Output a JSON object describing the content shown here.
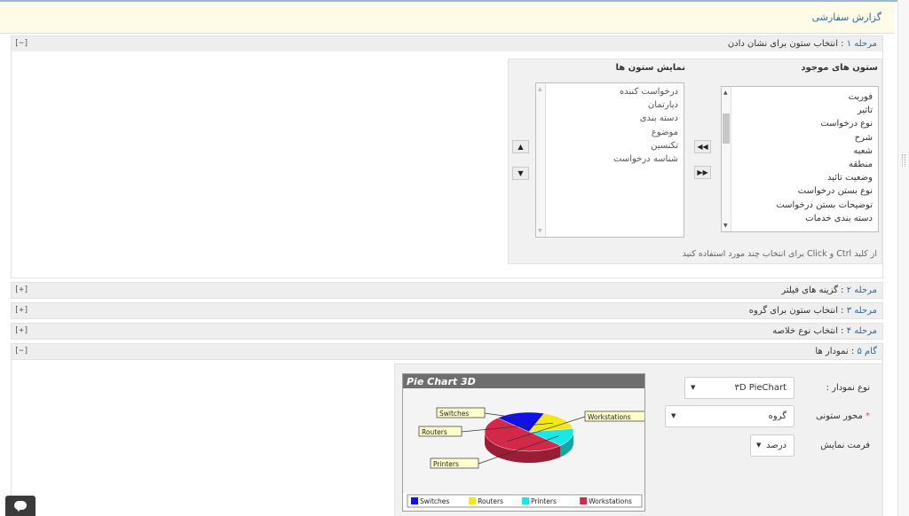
{
  "header": {
    "title": "گزارش سفارشی"
  },
  "steps": [
    {
      "num": "مرحله ۱",
      "title": "انتخاب ستون برای نشان دادن",
      "toggle": "[−]"
    },
    {
      "num": "مرحله ۲",
      "title": "گزینه های فیلتر",
      "toggle": "[+]"
    },
    {
      "num": "مرحله ۳",
      "title": "انتخاب ستون برای گروه",
      "toggle": "[+]"
    },
    {
      "num": "مرحله ۴",
      "title": "انتخاب نوع خلاصه",
      "toggle": "[+]"
    },
    {
      "num": "گام ۵",
      "title": "نمودار ها",
      "toggle": "[−]"
    }
  ],
  "step1": {
    "available_heading": "ستون های موجود",
    "display_heading": "نمایش ستون ها",
    "available_items": [
      "فوریت",
      "تاثیر",
      "نوع درخواست",
      "شرح",
      "شعبه",
      "منطقه",
      "وضعیت تائید",
      "نوع بستن درخواست",
      "توضیحات بستن درخواست",
      "دسته بندی خدمات"
    ],
    "display_items": [
      "درخواست کننده",
      "دپارتمان",
      "دسته بندی",
      "موضوع",
      "تکنسین",
      "شناسه درخواست"
    ],
    "hint": "از کلید Ctrl و Click برای انتخاب چند مورد استفاده کنید",
    "icons": {
      "move_left": "double-left-arrow-icon",
      "move_right": "double-right-arrow-icon",
      "move_up": "up-arrow-icon",
      "move_down": "down-arrow-icon"
    }
  },
  "step5": {
    "chart_type_label": "نوع نمودار :",
    "chart_type_value": "۳D PieChart",
    "axis_label": "محور ستونی",
    "axis_required_mark": "*",
    "axis_value": "گروه",
    "format_label": "فرمت نمایش",
    "format_value": "درصد"
  },
  "chart_data": {
    "type": "pie",
    "title": "Pie Chart 3D",
    "categories": [
      "Switches",
      "Routers",
      "Printers",
      "Workstations"
    ],
    "values": [
      18,
      17,
      15,
      50
    ],
    "colors": [
      "#1010e8",
      "#f0e818",
      "#18e8e8",
      "#d42848"
    ],
    "legend": "bottom"
  },
  "colors": {
    "link": "#2e6da4",
    "header_bg": "#fffbe6",
    "panel_bg": "#f1f1f1"
  }
}
